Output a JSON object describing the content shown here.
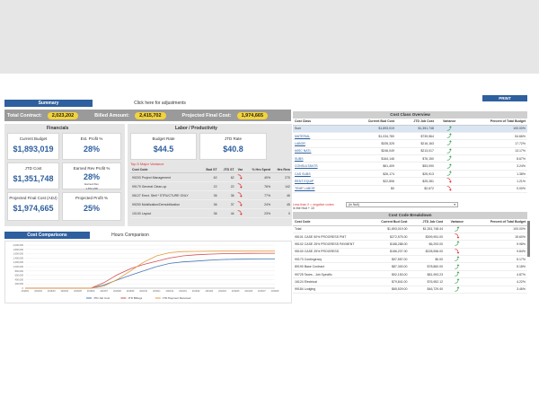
{
  "tabs": {
    "summary": "Summary",
    "adjust": "Click here for adjustments"
  },
  "kpi": {
    "total_contract_label": "Total Contract:",
    "total_contract_value": "2,023,202",
    "billed_amount_label": "Billed Amount:",
    "billed_amount_value": "2,415,702",
    "projected_final_cost_label": "Projected Final Cost:",
    "projected_final_cost_value": "1,974,665"
  },
  "financials": {
    "heading": "Financials",
    "current_budget": {
      "label": "Current Budget",
      "value": "$1,893,019"
    },
    "est_profit_pct": {
      "label": "Est. Profit %",
      "value": "28%"
    },
    "jtd_cost": {
      "label": "JTD Cost",
      "value": "$1,351,748"
    },
    "earned_rev_profit_pct": {
      "label": "Earned Rev Profit %",
      "value": "28%",
      "sub1": "Earned Rev",
      "sub2": "1,872,158"
    },
    "projected_final_cost": {
      "label": "Projected Final Cost (ADJ)",
      "value": "$1,974,665"
    },
    "projected_profit_pct": {
      "label": "Projected Profit %",
      "value": "25%"
    }
  },
  "labor": {
    "heading": "Labor / Productivity",
    "budget_rate": {
      "label": "Budget Rate",
      "value": "$44.5"
    },
    "jtd_rate": {
      "label": "JTD Rate",
      "value": "$40.8"
    },
    "variance_title": "Top 5 Major Variance",
    "columns": [
      "Cost Code",
      "Bud ST",
      "JTD ST",
      "Var",
      "% Hrs Spent",
      "Hrs Rem"
    ],
    "rows": [
      {
        "code": "99203 Project Management",
        "bud": "62",
        "jtd": "62",
        "pct": "40%",
        "rem": "270"
      },
      {
        "code": "99179 General Clean-up",
        "bud": "22",
        "jtd": "22",
        "pct": "76%",
        "rem": "142"
      },
      {
        "code": "06127 Erect. Stell * STRUCTURE ONLY",
        "bud": "36",
        "jtd": "36",
        "pct": "77%",
        "rem": "46"
      },
      {
        "code": "99200 Mobilization/Demobilization",
        "bud": "36",
        "jtd": "37",
        "pct": "24%",
        "rem": "45"
      },
      {
        "code": "10100 Layout",
        "bud": "36",
        "jtd": "44",
        "pct": "23%",
        "rem": "0"
      }
    ]
  },
  "chart_tabs": {
    "cost": "Cost Comparisons",
    "hours": "Hours Comparison"
  },
  "chart_data": {
    "type": "line",
    "categories": [
      "2018/01",
      "2018/02",
      "2018/03",
      "2018/04",
      "2018/05",
      "2018/06",
      "2018/07",
      "2018/08",
      "2018/09",
      "2018/10",
      "2018/11",
      "2018/12",
      "2019/01",
      "2019/02",
      "2019/03",
      "2019/04",
      "2019/05",
      "2019/06",
      "2019/07",
      "2019/08"
    ],
    "yticks": [
      "0",
      "200,000",
      "400,000",
      "600,000",
      "800,000",
      "1,000,000",
      "1,200,000",
      "1,400,000",
      "1,600,000",
      "1,800,000",
      "2,000,000"
    ],
    "ylim": [
      0,
      2000000
    ],
    "series": [
      {
        "name": "JTD Job Cost",
        "color": "#4a78b8",
        "values": [
          0,
          0,
          0,
          0,
          0,
          0,
          150000,
          380000,
          600000,
          800000,
          1000000,
          1150000,
          1220000,
          1260000,
          1300000,
          1330000,
          1340000,
          1345000,
          1348000,
          1351748
        ]
      },
      {
        "name": "JTD Billings",
        "color": "#d35050",
        "values": [
          0,
          0,
          0,
          0,
          0,
          0,
          260000,
          620000,
          900000,
          1100000,
          1250000,
          1400000,
          1500000,
          1550000,
          1580000,
          1600000,
          1610000,
          1615000,
          1620000,
          1620000
        ]
      },
      {
        "name": "JTD Payment Received",
        "color": "#e39a3c",
        "values": [
          0,
          0,
          0,
          0,
          0,
          0,
          100000,
          400000,
          800000,
          1200000,
          1500000,
          1650000,
          1700000,
          1710000,
          1715000,
          1720000,
          1720000,
          1720000,
          1720000,
          1720000
        ]
      }
    ],
    "legend": "bottom"
  },
  "print": "PRINT",
  "cost_class": {
    "heading": "Cost Class Overview",
    "columns": [
      "Cost Class",
      "Current Bud Cost",
      "JTD Job Cost",
      "Variance",
      "Percent of Total Budget"
    ],
    "rows": [
      {
        "name": "Sum",
        "bud": "$1,893,019",
        "jtd": "$1,351,748",
        "up": true,
        "pct": "100.00%"
      },
      {
        "name": "MATERIAL",
        "bud": "$1,034,780",
        "jtd": "$739,564",
        "up": true,
        "pct": "54.66%"
      },
      {
        "name": "LABOR",
        "bud": "$335,325",
        "jtd": "$216,163",
        "up": true,
        "pct": "17.72%"
      },
      {
        "name": "MISC NATL",
        "bud": "$246,049",
        "jtd": "$213,017",
        "up": true,
        "pct": "13.17%"
      },
      {
        "name": "SUBS",
        "bud": "$164,146",
        "jtd": "$76,150",
        "up": true,
        "pct": "8.67%"
      },
      {
        "name": "CONSULTANTS",
        "bud": "$61,409",
        "jtd": "$53,090",
        "up": true,
        "pct": "3.24%"
      },
      {
        "name": "CAS SUBS",
        "bud": "$26,174",
        "jtd": "$25,913",
        "up": true,
        "pct": "1.38%"
      },
      {
        "name": "RENT EQUIP",
        "bud": "$22,806",
        "jtd": "$25,281",
        "up": false,
        "pct": "1.21%"
      },
      {
        "name": "TEMP LABOR",
        "bud": "$0",
        "jtd": "$2,672",
        "up": false,
        "pct": "0.00%"
      }
    ]
  },
  "filter": {
    "line1": "Less than 0 = negative codes",
    "line2": "in the Hud + 10",
    "select_value": "(in Null)"
  },
  "cost_code": {
    "heading": "Cost Code Breakdown",
    "columns": [
      "Cost Code",
      "Current Bud Cost",
      "JTD Job Cost",
      "Variance",
      "Percent of Total Budget"
    ],
    "rows": [
      {
        "name": "Total",
        "bud": "$1,893,019.00",
        "jtd": "$1,351,748.44",
        "up": true,
        "pct": "100.00%"
      },
      {
        "name": "95101 CASE 50% PROGRESS PMT",
        "bud": "$272,575.00",
        "jtd": "$399,951.00",
        "up": false,
        "pct": "15.60%"
      },
      {
        "name": "95102 CASE 25% PROGRESS PAYMENT",
        "bud": "$188,288.00",
        "jtd": "$6,293.00",
        "up": true,
        "pct": "9.98%"
      },
      {
        "name": "95100 CASE 25% PROGRESS",
        "bud": "$186,207.00",
        "jtd": "$228,556.00",
        "up": false,
        "pct": "9.84%"
      },
      {
        "name": "99173 Contingency",
        "bud": "$97,557.00",
        "jtd": "$0.00",
        "up": true,
        "pct": "5.17%"
      },
      {
        "name": "89190 Base Contract",
        "bud": "$87,300.00",
        "jtd": "$78,860.00",
        "up": true,
        "pct": "5.18%"
      },
      {
        "name": "99725 Taxes - Job Specific",
        "bud": "$92,153.00",
        "jtd": "$81,993.23",
        "up": true,
        "pct": "4.87%"
      },
      {
        "name": "16124 Electrical",
        "bud": "$79,841.00",
        "jtd": "$76,952.12",
        "up": true,
        "pct": "4.22%"
      },
      {
        "name": "99184 Lodging",
        "bud": "$65,529.00",
        "jtd": "$46,729.40",
        "up": true,
        "pct": "3.46%"
      }
    ]
  }
}
